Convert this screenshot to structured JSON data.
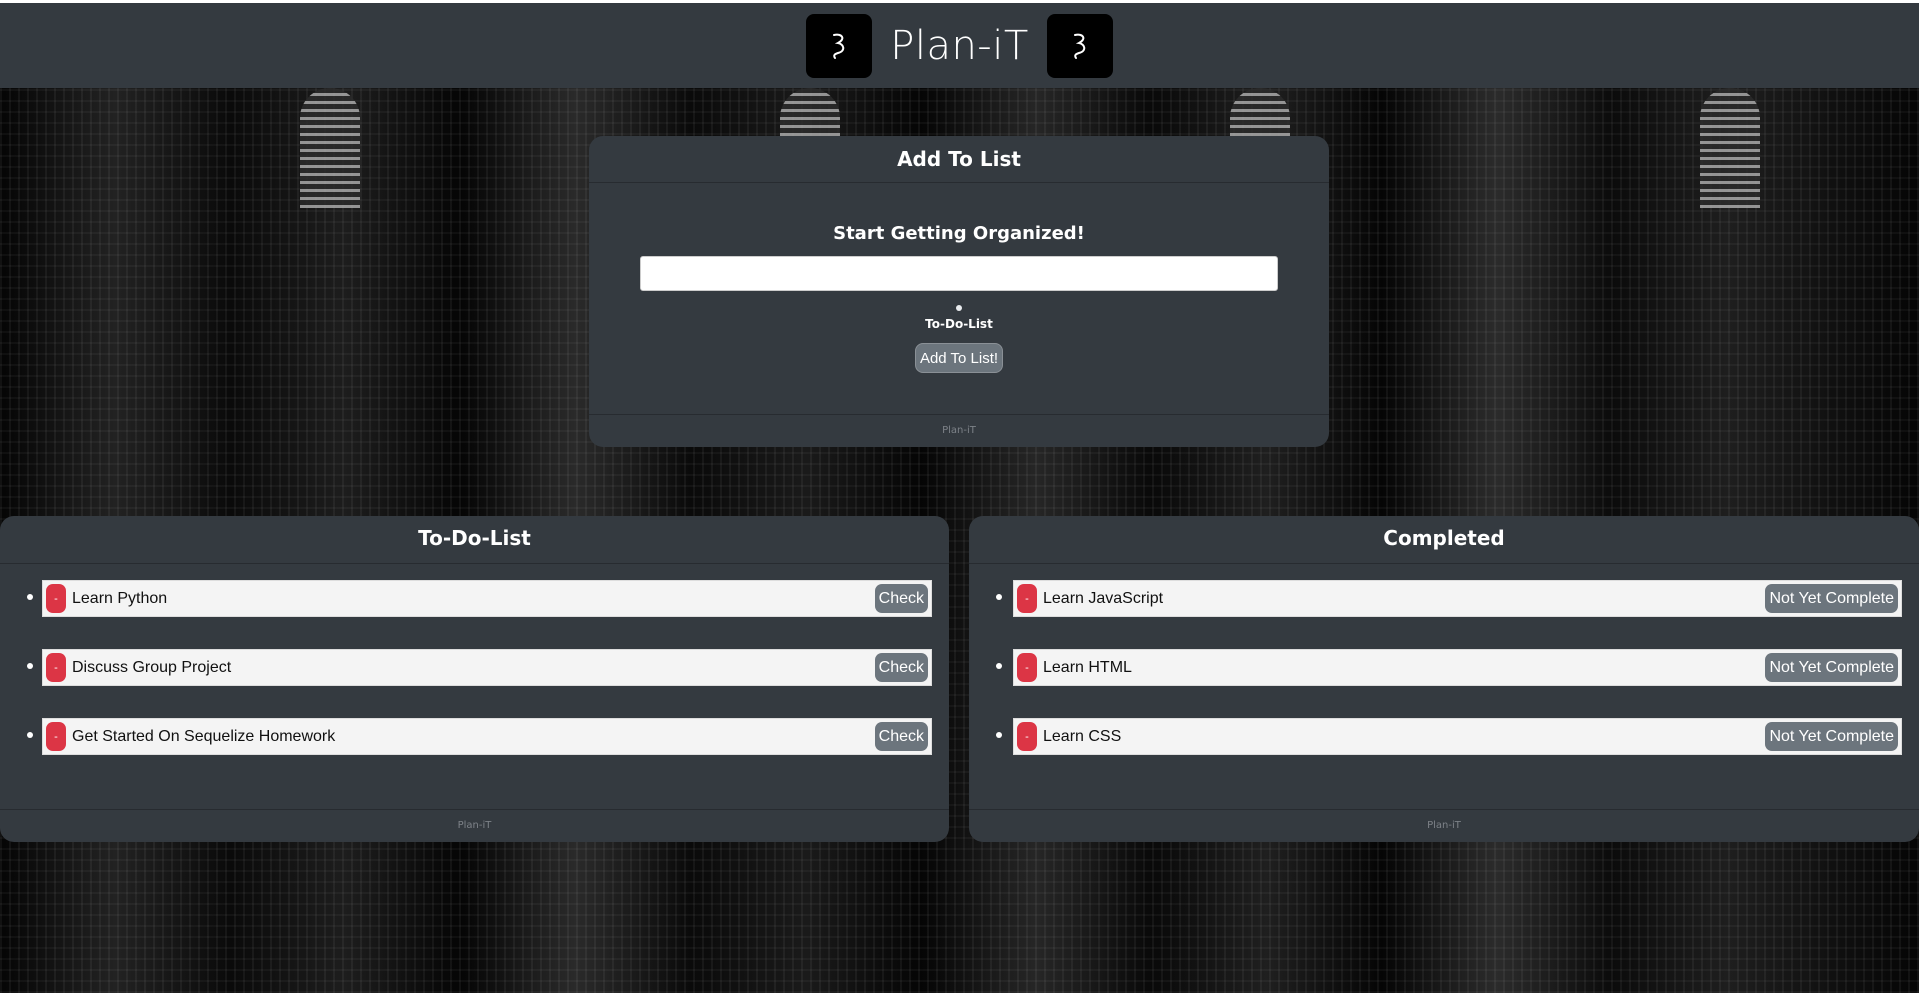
{
  "header": {
    "title": "Plan-iT",
    "logo_icon": "hook-icon"
  },
  "add_card": {
    "title": "Add To List",
    "subtitle": "Start Getting Organized!",
    "input_value": "",
    "input_placeholder": "",
    "radio_label": "To-Do-List",
    "button_label": "Add To List!",
    "footer": "Plan-iT"
  },
  "todo": {
    "title": "To-Do-List",
    "footer": "Plan-iT",
    "items": [
      {
        "delete_label": "-",
        "text": "Learn Python",
        "action_label": "Check"
      },
      {
        "delete_label": "-",
        "text": "Discuss Group Project",
        "action_label": "Check"
      },
      {
        "delete_label": "-",
        "text": "Get Started On Sequelize Homework",
        "action_label": "Check"
      }
    ]
  },
  "completed": {
    "title": "Completed",
    "footer": "Plan-iT",
    "items": [
      {
        "delete_label": "-",
        "text": "Learn JavaScript",
        "action_label": "Not Yet Complete"
      },
      {
        "delete_label": "-",
        "text": "Learn HTML",
        "action_label": "Not Yet Complete"
      },
      {
        "delete_label": "-",
        "text": "Learn CSS",
        "action_label": "Not Yet Complete"
      }
    ]
  },
  "colors": {
    "panel": "#343a40",
    "delete": "#dc3545",
    "secondary": "#6c757d"
  }
}
